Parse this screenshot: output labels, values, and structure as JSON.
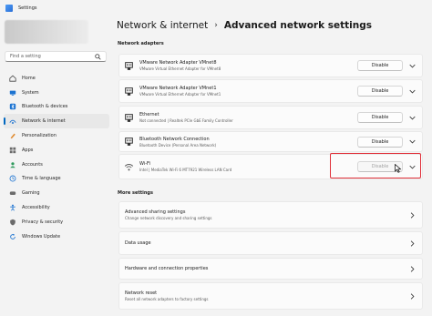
{
  "window": {
    "title": "Settings"
  },
  "sidebar": {
    "search_placeholder": "Find a setting",
    "items": [
      {
        "label": "Home",
        "icon": "home-icon",
        "color": "#444444"
      },
      {
        "label": "System",
        "icon": "system-icon",
        "color": "#1c73d1"
      },
      {
        "label": "Bluetooth & devices",
        "icon": "bluetooth-icon",
        "color": "#1c73d1"
      },
      {
        "label": "Network & internet",
        "icon": "network-icon",
        "color": "#1c73d1",
        "active": true
      },
      {
        "label": "Personalization",
        "icon": "personalization-icon",
        "color": "#e08a2e"
      },
      {
        "label": "Apps",
        "icon": "apps-icon",
        "color": "#6b6b6b"
      },
      {
        "label": "Accounts",
        "icon": "accounts-icon",
        "color": "#2e9a5c"
      },
      {
        "label": "Time & language",
        "icon": "time-icon",
        "color": "#1c73d1"
      },
      {
        "label": "Gaming",
        "icon": "gaming-icon",
        "color": "#6b6b6b"
      },
      {
        "label": "Accessibility",
        "icon": "accessibility-icon",
        "color": "#1c73d1"
      },
      {
        "label": "Privacy & security",
        "icon": "shield-icon",
        "color": "#6b6b6b"
      },
      {
        "label": "Windows Update",
        "icon": "update-icon",
        "color": "#1c73d1"
      }
    ]
  },
  "main": {
    "breadcrumb_parent": "Network & internet",
    "breadcrumb_sep": "›",
    "breadcrumb_current": "Advanced network settings",
    "adapters_title": "Network adapters",
    "adapters": [
      {
        "name": "VMware Network Adapter VMnet8",
        "desc": "VMware Virtual Ethernet Adapter for VMnet8",
        "button": "Disable",
        "icon": "ethernet-icon"
      },
      {
        "name": "VMware Network Adapter VMnet1",
        "desc": "VMware Virtual Ethernet Adapter for VMnet1",
        "button": "Disable",
        "icon": "ethernet-icon"
      },
      {
        "name": "Ethernet",
        "desc": "Not connected | Realtek PCIe GbE Family Controller",
        "button": "Disable",
        "icon": "ethernet-icon"
      },
      {
        "name": "Bluetooth Network Connection",
        "desc": "Bluetooth Device (Personal Area Network)",
        "button": "Disable",
        "icon": "ethernet-icon"
      },
      {
        "name": "Wi-Fi",
        "desc": "Intel | MediaTek Wi-Fi 6 MT7921 Wireless LAN Card",
        "button": "Disable",
        "icon": "wifi-icon"
      }
    ],
    "more_title": "More settings",
    "more": [
      {
        "name": "Advanced sharing settings",
        "desc": "Change network discovery and sharing settings"
      },
      {
        "name": "Data usage",
        "desc": ""
      },
      {
        "name": "Hardware and connection properties",
        "desc": ""
      },
      {
        "name": "Network reset",
        "desc": "Reset all network adapters to factory settings"
      }
    ]
  },
  "colors": {
    "accent": "#0067c0",
    "highlight": "#e0303a"
  }
}
